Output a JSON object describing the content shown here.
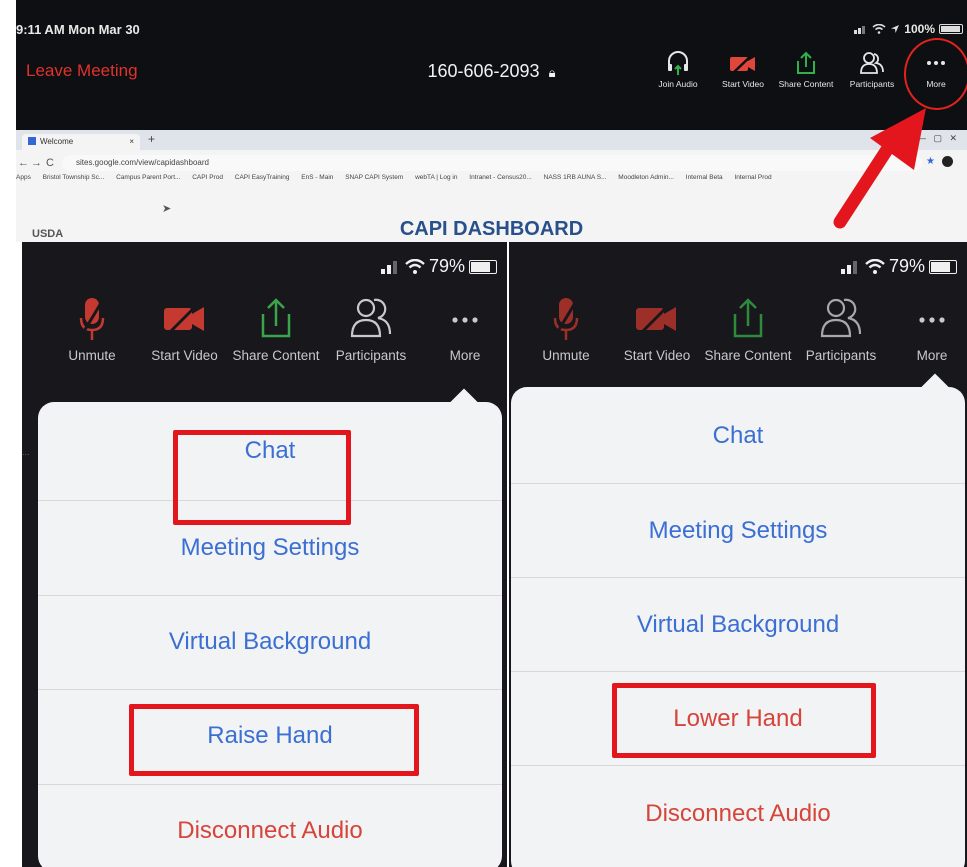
{
  "colors": {
    "accent_red": "#e0322c",
    "link_blue": "#3b6fd3",
    "annotation_red": "#e3161d"
  },
  "top": {
    "status_time": "9:11 AM  Mon Mar 30",
    "battery_pct": "100%",
    "leave_label": "Leave Meeting",
    "meeting_id": "160-606-2093",
    "toolbar": {
      "join_audio": "Join Audio",
      "start_video": "Start Video",
      "share_content": "Share Content",
      "participants": "Participants",
      "more": "More"
    },
    "browser": {
      "tab_title": "Welcome",
      "url": "sites.google.com/view/capidashboard",
      "bookmarks": [
        "Apps",
        "Bristol Township Sc...",
        "Campus Parent Port...",
        "CAPI Prod",
        "CAPI EasyTraining",
        "EnS - Main",
        "SNAP CAPI System",
        "webTA | Log in",
        "Intranet - Census20...",
        "NASS 1RB AUNA S...",
        "Moodleton Admin...",
        "Internal Beta",
        "Internal Prod"
      ],
      "page_heading": "CAPI DASHBOARD",
      "logo_text": "USDA"
    }
  },
  "left_phone": {
    "battery_pct": "79%",
    "toolbar": {
      "unmute": "Unmute",
      "start_video": "Start Video",
      "share_content": "Share Content",
      "participants": "Participants",
      "more": "More"
    },
    "menu": {
      "chat": "Chat",
      "meeting_settings": "Meeting Settings",
      "virtual_background": "Virtual Background",
      "raise_hand": "Raise Hand",
      "disconnect_audio": "Disconnect Audio"
    }
  },
  "right_phone": {
    "battery_pct": "79%",
    "toolbar": {
      "unmute": "Unmute",
      "start_video": "Start Video",
      "share_content": "Share Content",
      "participants": "Participants",
      "more": "More"
    },
    "menu": {
      "chat": "Chat",
      "meeting_settings": "Meeting Settings",
      "virtual_background": "Virtual Background",
      "lower_hand": "Lower Hand",
      "disconnect_audio": "Disconnect Audio"
    }
  }
}
